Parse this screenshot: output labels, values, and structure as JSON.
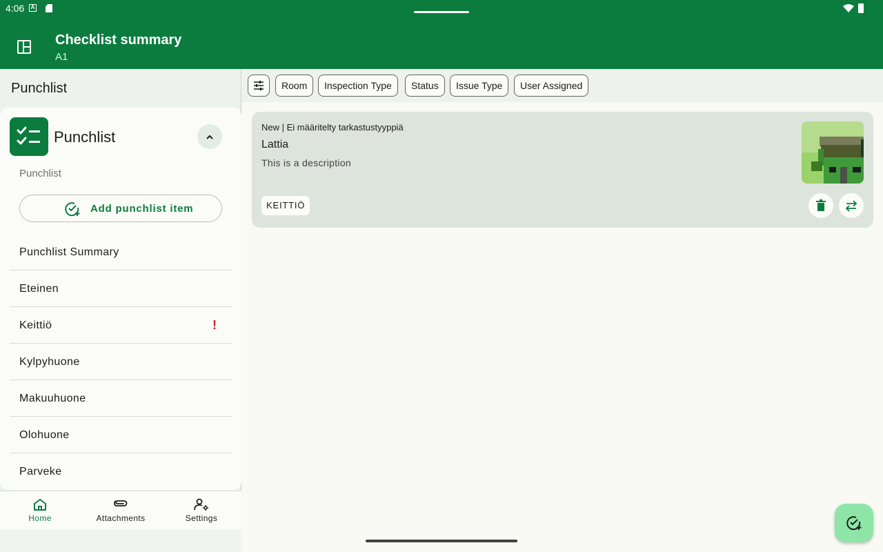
{
  "status_bar": {
    "time": "4:06",
    "icons": [
      "a-notification-icon",
      "sd-card-icon",
      "wifi-icon",
      "battery-icon"
    ]
  },
  "app_bar": {
    "title": "Checklist summary",
    "subtitle": "A1",
    "icon": "panel-toggle-icon"
  },
  "sidebar": {
    "heading": "Punchlist",
    "card": {
      "title": "Punchlist",
      "subtitle": "Punchlist",
      "add_button_label": "Add punchlist item",
      "collapse_icon": "chevron-up-icon"
    },
    "items": [
      {
        "label": "Punchlist Summary",
        "alert": ""
      },
      {
        "label": "Eteinen",
        "alert": ""
      },
      {
        "label": "Keittiö",
        "alert": "!"
      },
      {
        "label": "Kylpyhuone",
        "alert": ""
      },
      {
        "label": "Makuuhuone",
        "alert": ""
      },
      {
        "label": "Olohuone",
        "alert": ""
      },
      {
        "label": "Parveke",
        "alert": ""
      }
    ]
  },
  "bottom_nav": [
    {
      "label": "Home",
      "icon": "home-icon",
      "active": true
    },
    {
      "label": "Attachments",
      "icon": "paperclip-icon",
      "active": false
    },
    {
      "label": "Settings",
      "icon": "user-settings-icon",
      "active": false
    }
  ],
  "filters": {
    "icon": "tune-icon",
    "chips": [
      "Room",
      "Inspection Type",
      "Status",
      "Issue Type",
      "User Assigned"
    ]
  },
  "issue_card": {
    "meta": "New | Ei määritelty tarkastustyyppiä",
    "title": "Lattia",
    "description": "This is a description",
    "room_tag": "KEITTIÖ",
    "actions": [
      "trash-icon",
      "swap-icon"
    ]
  },
  "fab": {
    "icon": "add-check-icon"
  },
  "colors": {
    "brand": "#0b7c3e",
    "fab": "#8de6a7",
    "alert": "#d21e1e",
    "card": "#dde4dc"
  }
}
